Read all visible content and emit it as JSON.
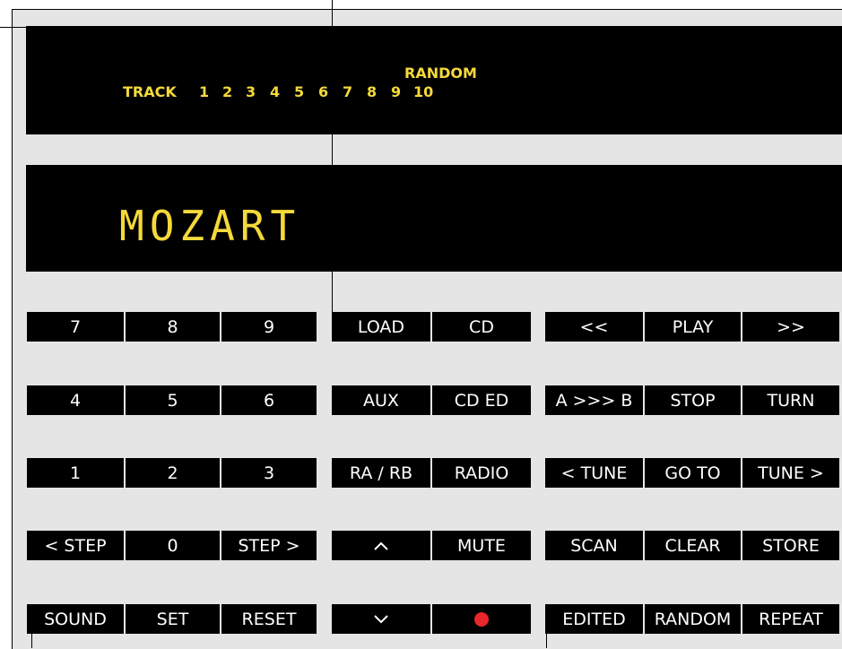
{
  "display": {
    "random_indicator": "RANDOM",
    "track_label": "TRACK",
    "track_numbers": [
      "1",
      "2",
      "3",
      "4",
      "5",
      "6",
      "7",
      "8",
      "9",
      "10"
    ],
    "main_text": "MOZART",
    "text_color": "#f5d93a"
  },
  "keypad": {
    "rows": [
      [
        "7",
        "8",
        "9"
      ],
      [
        "4",
        "5",
        "6"
      ],
      [
        "1",
        "2",
        "3"
      ],
      [
        "< STEP",
        "0",
        "STEP >"
      ],
      [
        "SOUND",
        "SET",
        "RESET"
      ]
    ]
  },
  "source": {
    "rows": [
      [
        "LOAD",
        "CD"
      ],
      [
        "AUX",
        "CD ED"
      ],
      [
        "RA / RB",
        "RADIO"
      ],
      [
        "up-chevron-icon",
        "MUTE"
      ],
      [
        "down-chevron-icon",
        "record-icon"
      ]
    ]
  },
  "transport": {
    "rows": [
      [
        "<<",
        "PLAY",
        ">>"
      ],
      [
        "A >>> B",
        "STOP",
        "TURN"
      ],
      [
        "< TUNE",
        "GO TO",
        "TUNE >"
      ],
      [
        "SCAN",
        "CLEAR",
        "STORE"
      ],
      [
        "EDITED",
        "RANDOM",
        "REPEAT"
      ]
    ]
  },
  "colors": {
    "panel": "#e5e5e5",
    "button": "#000000",
    "button_text": "#ffffff",
    "record": "#e8262c"
  }
}
